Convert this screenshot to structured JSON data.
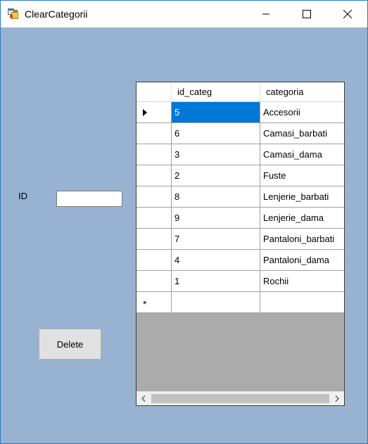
{
  "window": {
    "title": "ClearCategorii"
  },
  "form": {
    "id_label": "ID",
    "id_value": "",
    "delete_label": "Delete"
  },
  "grid": {
    "columns": [
      "id_categ",
      "categoria"
    ],
    "rows": [
      {
        "id": "5",
        "categoria": "Accesorii"
      },
      {
        "id": "6",
        "categoria": "Camasi_barbati"
      },
      {
        "id": "3",
        "categoria": "Camasi_dama"
      },
      {
        "id": "2",
        "categoria": "Fuste"
      },
      {
        "id": "8",
        "categoria": "Lenjerie_barbati"
      },
      {
        "id": "9",
        "categoria": "Lenjerie_dama"
      },
      {
        "id": "7",
        "categoria": "Pantaloni_barbati"
      },
      {
        "id": "4",
        "categoria": "Pantaloni_dama"
      },
      {
        "id": "1",
        "categoria": "Rochii"
      }
    ],
    "new_row_marker": "*",
    "selected_row": 0
  },
  "colors": {
    "form_background": "#98b3d1",
    "selection": "#0078d7",
    "window_border": "#2b79c2"
  },
  "icons": {
    "app": "winforms-app-icon",
    "minimize": "minimize-icon",
    "maximize": "maximize-icon",
    "close": "close-icon",
    "current_row": "row-pointer-icon",
    "scroll_left": "chevron-left-icon",
    "scroll_right": "chevron-right-icon"
  }
}
